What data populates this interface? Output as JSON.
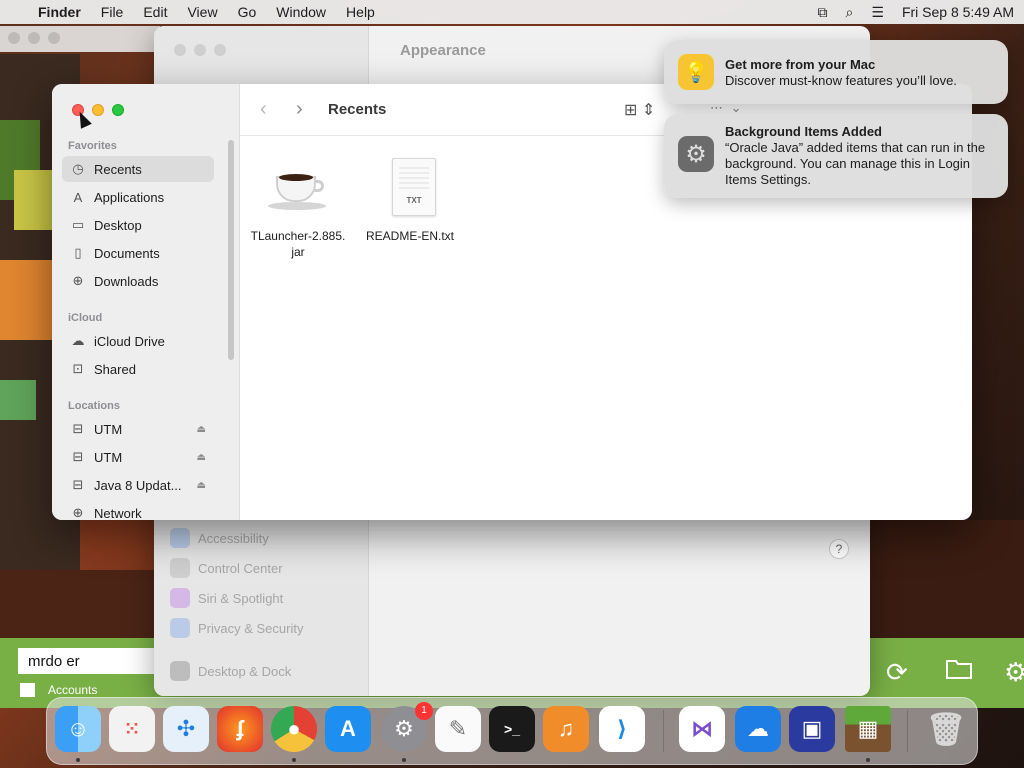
{
  "menubar": {
    "app_name": "Finder",
    "menus": [
      "File",
      "Edit",
      "View",
      "Go",
      "Window",
      "Help"
    ],
    "datetime": "Fri Sep 8  5:49 AM"
  },
  "settings_window": {
    "title": "Appearance",
    "sidebar_items": [
      "Accessibility",
      "Control Center",
      "Siri & Spotlight",
      "Privacy & Security",
      "Desktop & Dock"
    ],
    "help_label": "?"
  },
  "finder": {
    "title": "Recents",
    "sections": {
      "favorites": "Favorites",
      "icloud": "iCloud",
      "locations": "Locations"
    },
    "favorites": [
      {
        "label": "Recents",
        "icon": "clock-icon",
        "active": true
      },
      {
        "label": "Applications",
        "icon": "applications-icon"
      },
      {
        "label": "Desktop",
        "icon": "desktop-icon"
      },
      {
        "label": "Documents",
        "icon": "document-icon"
      },
      {
        "label": "Downloads",
        "icon": "download-icon"
      }
    ],
    "icloud": [
      {
        "label": "iCloud Drive",
        "icon": "cloud-icon"
      },
      {
        "label": "Shared",
        "icon": "shared-folder-icon"
      }
    ],
    "locations": [
      {
        "label": "UTM",
        "icon": "drive-icon",
        "eject": true
      },
      {
        "label": "UTM",
        "icon": "drive-icon",
        "eject": true
      },
      {
        "label": "Java 8 Updat...",
        "icon": "drive-icon",
        "eject": true
      },
      {
        "label": "Network",
        "icon": "network-icon"
      }
    ],
    "files": [
      {
        "name": "TLauncher-2.885.\njar",
        "line1": "TLauncher-2.885.",
        "line2": "jar",
        "icon": "java-jar-icon"
      },
      {
        "name": "README-EN.txt",
        "line1": "README-EN.txt",
        "line2": "",
        "icon": "txt-file-icon",
        "ext": "TXT"
      }
    ]
  },
  "notifications": [
    {
      "title": "Get more from your Mac",
      "body": "Discover must-know features you’ll love.",
      "icon": "lightbulb-icon"
    },
    {
      "title": "Background Items Added",
      "body": "“Oracle Java” added items that can run in the background. You can manage this in Login Items Settings.",
      "icon": "settings-gear-icon"
    }
  ],
  "launcher": {
    "username": "mrdo er",
    "accounts_label": "Accounts"
  },
  "dock": {
    "badge": "1",
    "apps": [
      "finder-icon",
      "launchpad-icon",
      "safari-icon",
      "firefox-icon",
      "chrome-icon",
      "app-store-icon",
      "system-settings-icon",
      "textedit-icon",
      "terminal-icon",
      "garageband-icon",
      "vscode-icon",
      "visual-studio-icon",
      "cloud-app-icon",
      "utm-icon",
      "minecraft-icon",
      "trash-icon"
    ]
  },
  "colors": {
    "launcher_green": "#79b046",
    "finder_sidebar": "#eeeeef",
    "traffic_close": "#ff5f57",
    "traffic_min": "#febc2e",
    "traffic_max": "#28c840"
  }
}
